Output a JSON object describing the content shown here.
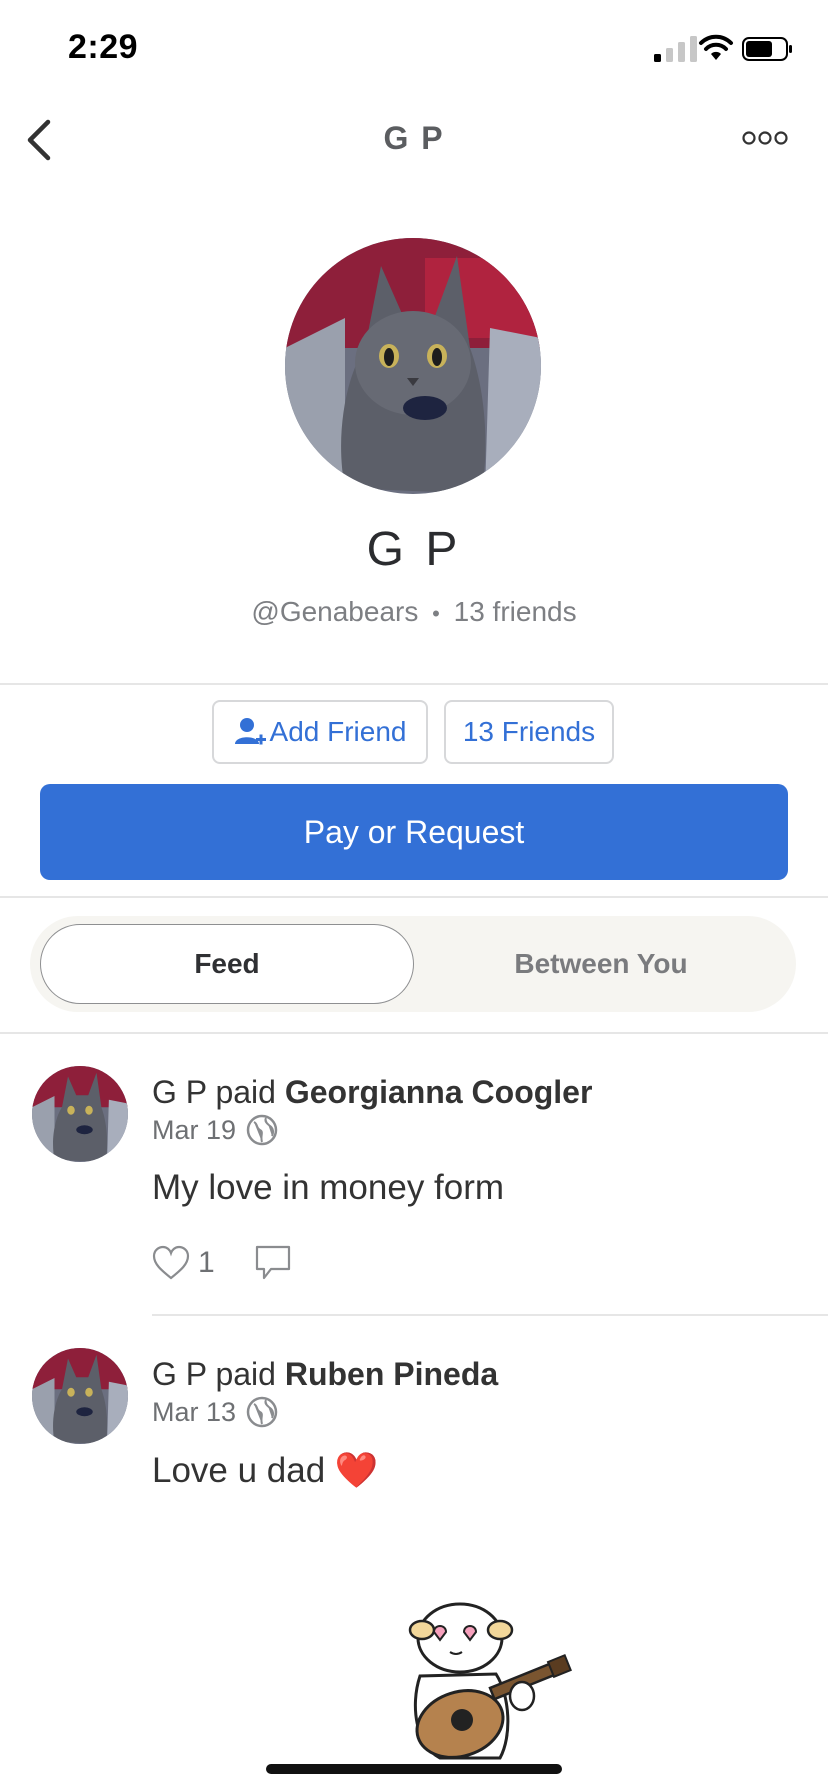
{
  "status_bar": {
    "time": "2:29"
  },
  "nav": {
    "title": "G P"
  },
  "profile": {
    "name": "G P",
    "username": "@Genabears",
    "separator": "•",
    "friends_count": "13 friends"
  },
  "actions": {
    "add_friend": "Add Friend",
    "friends": "13 Friends",
    "pay_request": "Pay or Request"
  },
  "tabs": [
    {
      "label": "Feed",
      "selected": true
    },
    {
      "label": "Between You",
      "selected": false
    }
  ],
  "feed": [
    {
      "payer": "G P",
      "verb": "paid",
      "payee": "Georgianna Coogler",
      "date": "Mar 19",
      "note": "My love in money form",
      "likes": "1"
    },
    {
      "payer": "G P",
      "verb": "paid",
      "payee": "Ruben Pineda",
      "date": "Mar 13",
      "note": "Love u dad ❤️"
    }
  ],
  "colors": {
    "accent": "#3370d6",
    "segment_bg": "#f6f5f1"
  },
  "icons": [
    "back-icon",
    "more-icon",
    "add-person-icon",
    "globe-icon",
    "heart-icon",
    "comment-icon"
  ]
}
